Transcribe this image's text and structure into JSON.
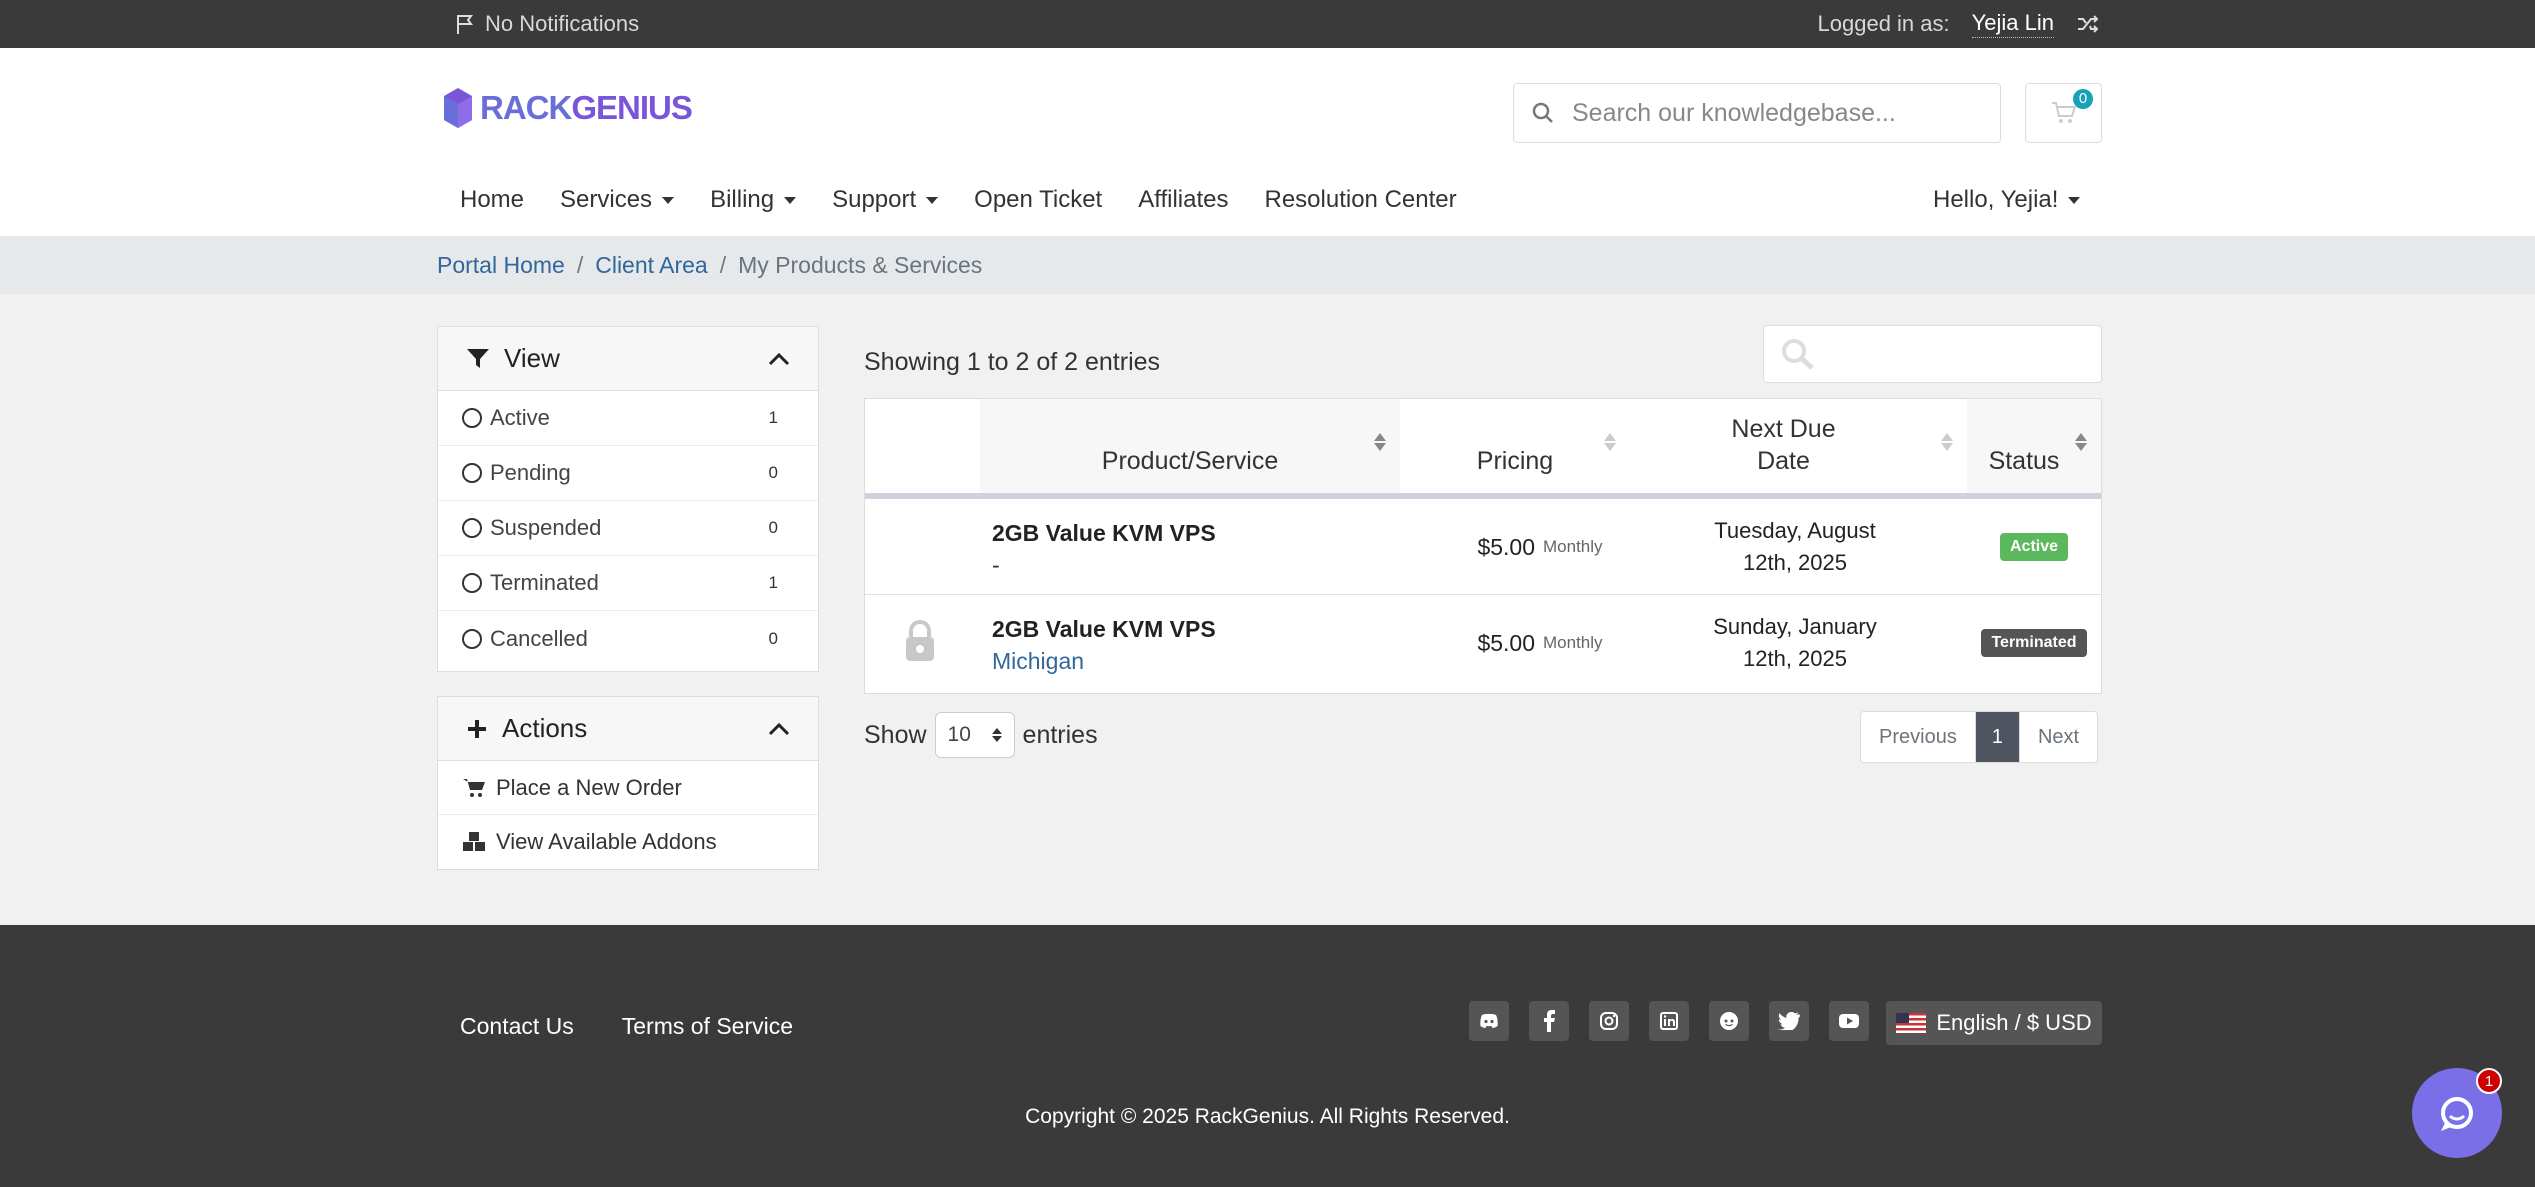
{
  "topbar": {
    "notifications": "No Notifications",
    "logged_in_label": "Logged in as:",
    "user": "Yejia Lin"
  },
  "logo": {
    "part1": "RACK",
    "part2": "GENIUS",
    "color1": "#6a6fd8",
    "color2": "#7b55d9"
  },
  "search": {
    "placeholder": "Search our knowledgebase..."
  },
  "cart": {
    "count": "0"
  },
  "nav": {
    "items": [
      {
        "label": "Home"
      },
      {
        "label": "Services"
      },
      {
        "label": "Billing"
      },
      {
        "label": "Support"
      },
      {
        "label": "Open Ticket"
      },
      {
        "label": "Affiliates"
      },
      {
        "label": "Resolution Center"
      }
    ],
    "hello": "Hello, Yejia!"
  },
  "breadcrumb": {
    "home": "Portal Home",
    "client": "Client Area",
    "current": "My Products & Services"
  },
  "view_panel": {
    "title": "View",
    "filters": [
      {
        "label": "Active",
        "count": "1"
      },
      {
        "label": "Pending",
        "count": "0"
      },
      {
        "label": "Suspended",
        "count": "0"
      },
      {
        "label": "Terminated",
        "count": "1"
      },
      {
        "label": "Cancelled",
        "count": "0"
      }
    ]
  },
  "actions_panel": {
    "title": "Actions",
    "items": [
      {
        "label": "Place a New Order"
      },
      {
        "label": "View Available Addons"
      }
    ]
  },
  "table": {
    "showing": "Showing 1 to 2 of 2 entries",
    "headers": {
      "product": "Product/Service",
      "pricing": "Pricing",
      "due_line1": "Next Due",
      "due_line2": "Date",
      "status": "Status"
    },
    "rows": [
      {
        "name": "2GB Value KVM VPS",
        "sub": "-",
        "price": "$5.00",
        "cycle": "Monthly",
        "due_line1": "Tuesday, August",
        "due_line2": "12th, 2025",
        "status": "Active",
        "status_color": "#5cb85c"
      },
      {
        "name": "2GB Value KVM VPS",
        "sub": "Michigan",
        "price": "$5.00",
        "cycle": "Monthly",
        "due_line1": "Sunday, January",
        "due_line2": "12th, 2025",
        "status": "Terminated",
        "status_color": "#555555"
      }
    ],
    "show_label": "Show",
    "page_size": "10",
    "entries_label": "entries",
    "pager": {
      "prev": "Previous",
      "page": "1",
      "next": "Next"
    }
  },
  "footer": {
    "links": [
      {
        "label": "Contact Us"
      },
      {
        "label": "Terms of Service"
      }
    ],
    "language": "English / $ USD",
    "copyright": "Copyright © 2025 RackGenius. All Rights Reserved.",
    "chat_badge": "1"
  }
}
